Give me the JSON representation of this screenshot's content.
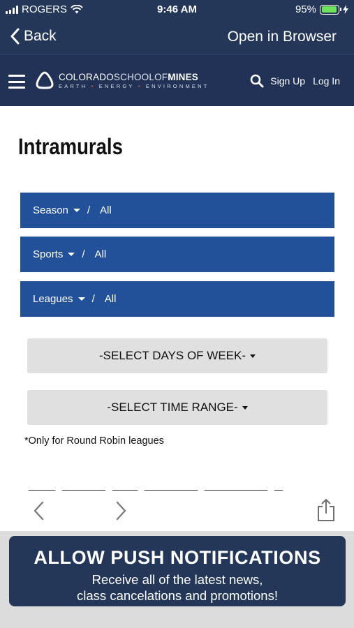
{
  "status_bar": {
    "carrier": "ROGERS",
    "time": "9:46 AM",
    "battery": "95%",
    "battery_level": 0.95,
    "icons": [
      "signal-icon",
      "wifi-icon",
      "battery-icon",
      "charging-bolt-icon"
    ]
  },
  "browser_bar": {
    "back_label": "Back",
    "open_in_browser_label": "Open in Browser"
  },
  "site_header": {
    "logo": {
      "name_regular": "COLORADO",
      "name_light": "SCHOOLOF",
      "name_bold": "MINES",
      "tagline_parts": [
        "EARTH",
        "ENERGY",
        "ENVIRONMENT"
      ],
      "tagline_dot_color": "#e0632c"
    },
    "sign_up": "Sign Up",
    "log_in": "Log In",
    "colors": {
      "background": "#223257"
    }
  },
  "page": {
    "title": "Intramurals",
    "filters": [
      {
        "label": "Season",
        "separator": "/",
        "value": "All"
      },
      {
        "label": "Sports",
        "separator": "/",
        "value": "All"
      },
      {
        "label": "Leagues",
        "separator": "/",
        "value": "All"
      }
    ],
    "day_selector": "-SELECT DAYS OF WEEK-",
    "time_selector": "-SELECT TIME RANGE-",
    "note": "*Only for Round Robin leagues",
    "colors": {
      "filter_bar": "#22519a",
      "selector_bg": "#e0e0e0"
    }
  },
  "toolbar": {
    "icons": [
      "back-arrow-icon",
      "forward-arrow-icon",
      "share-icon"
    ]
  },
  "promo": {
    "title": "ALLOW PUSH NOTIFICATIONS",
    "line1": "Receive all of the latest news,",
    "line2": "class cancelations and promotions!",
    "colors": {
      "background": "#243758"
    }
  }
}
